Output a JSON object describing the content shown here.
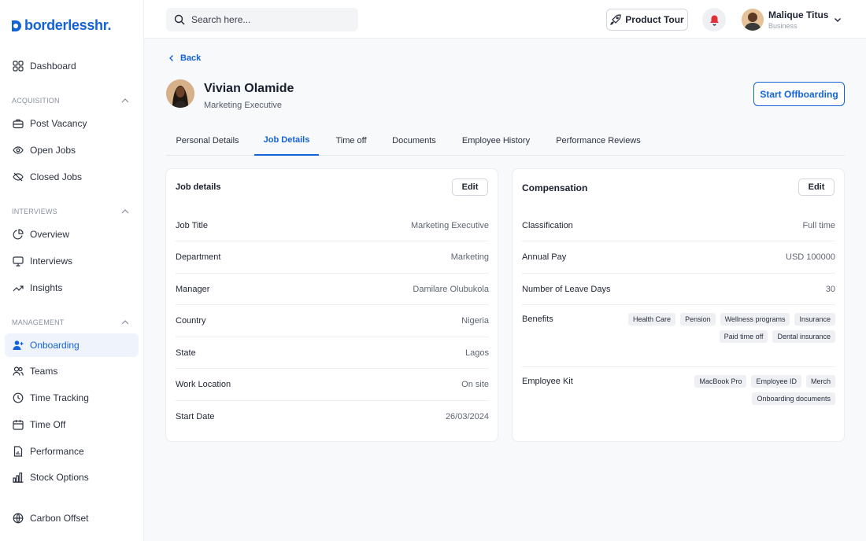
{
  "app": {
    "logo_text": "borderlesshr."
  },
  "sidebar": {
    "items_top": [
      {
        "label": "Dashboard"
      }
    ],
    "acquisition": {
      "title": "ACQUISITION",
      "items": [
        {
          "label": "Post Vacancy"
        },
        {
          "label": "Open Jobs"
        },
        {
          "label": "Closed Jobs"
        }
      ]
    },
    "interviews": {
      "title": "INTERVIEWS",
      "items": [
        {
          "label": "Overview"
        },
        {
          "label": "Interviews"
        },
        {
          "label": "Insights"
        }
      ]
    },
    "management": {
      "title": "MANAGEMENT",
      "items": [
        {
          "label": "Onboarding"
        },
        {
          "label": "Teams"
        },
        {
          "label": "Time Tracking"
        },
        {
          "label": "Time Off"
        },
        {
          "label": "Performance"
        },
        {
          "label": "Stock Options"
        }
      ]
    },
    "bottom": {
      "label": "Carbon Offset"
    }
  },
  "topbar": {
    "search_placeholder": "Search here...",
    "product_tour": "Product Tour",
    "user_name": "Malique Titus",
    "user_role": "Business"
  },
  "header": {
    "back": "Back",
    "employee_name": "Vivian Olamide",
    "employee_title": "Marketing Executive",
    "offboard_button": "Start Offboarding"
  },
  "tabs": [
    {
      "label": "Personal Details"
    },
    {
      "label": "Job Details"
    },
    {
      "label": "Time off"
    },
    {
      "label": "Documents"
    },
    {
      "label": "Employee History"
    },
    {
      "label": "Performance Reviews"
    }
  ],
  "active_tab": "Job Details",
  "job_details": {
    "title": "Job details",
    "edit": "Edit",
    "rows": [
      {
        "label": "Job Title",
        "value": "Marketing Executive"
      },
      {
        "label": "Department",
        "value": "Marketing"
      },
      {
        "label": "Manager",
        "value": "Damilare Olubukola"
      },
      {
        "label": "Country",
        "value": "Nigeria"
      },
      {
        "label": "State",
        "value": "Lagos"
      },
      {
        "label": "Work Location",
        "value": "On site"
      },
      {
        "label": "Start Date",
        "value": "26/03/2024"
      }
    ]
  },
  "compensation": {
    "title": "Compensation",
    "edit": "Edit",
    "rows": [
      {
        "label": "Classification",
        "value": "Full time"
      },
      {
        "label": "Annual Pay",
        "value": "USD 100000"
      },
      {
        "label": "Number of Leave Days",
        "value": "30"
      }
    ],
    "benefits": {
      "label": "Benefits",
      "chips": [
        "Health Care",
        "Pension",
        "Wellness programs",
        "Insurance",
        "Paid time off",
        "Dental insurance"
      ]
    },
    "employee_kit": {
      "label": "Employee Kit",
      "chips": [
        "MacBook Pro",
        "Employee ID",
        "Merch",
        "Onboarding documents"
      ]
    }
  },
  "colors": {
    "accent": "#1463d6",
    "active_bg": "#eef3fc",
    "bell": "#e0313b"
  }
}
